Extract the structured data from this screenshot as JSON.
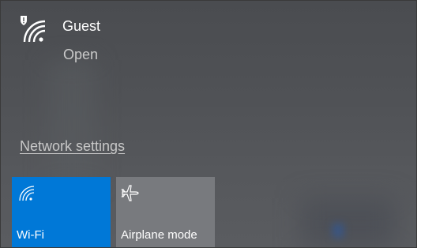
{
  "network": {
    "name": "Guest",
    "status": "Open",
    "icon": "wifi-secured-warning-icon"
  },
  "links": {
    "network_settings": "Network settings"
  },
  "quick_actions": [
    {
      "label": "Wi-Fi",
      "icon": "wifi-icon",
      "active": true,
      "color": "#0078d7"
    },
    {
      "label": "Airplane mode",
      "icon": "airplane-icon",
      "active": false,
      "color": "#787a7e"
    }
  ]
}
